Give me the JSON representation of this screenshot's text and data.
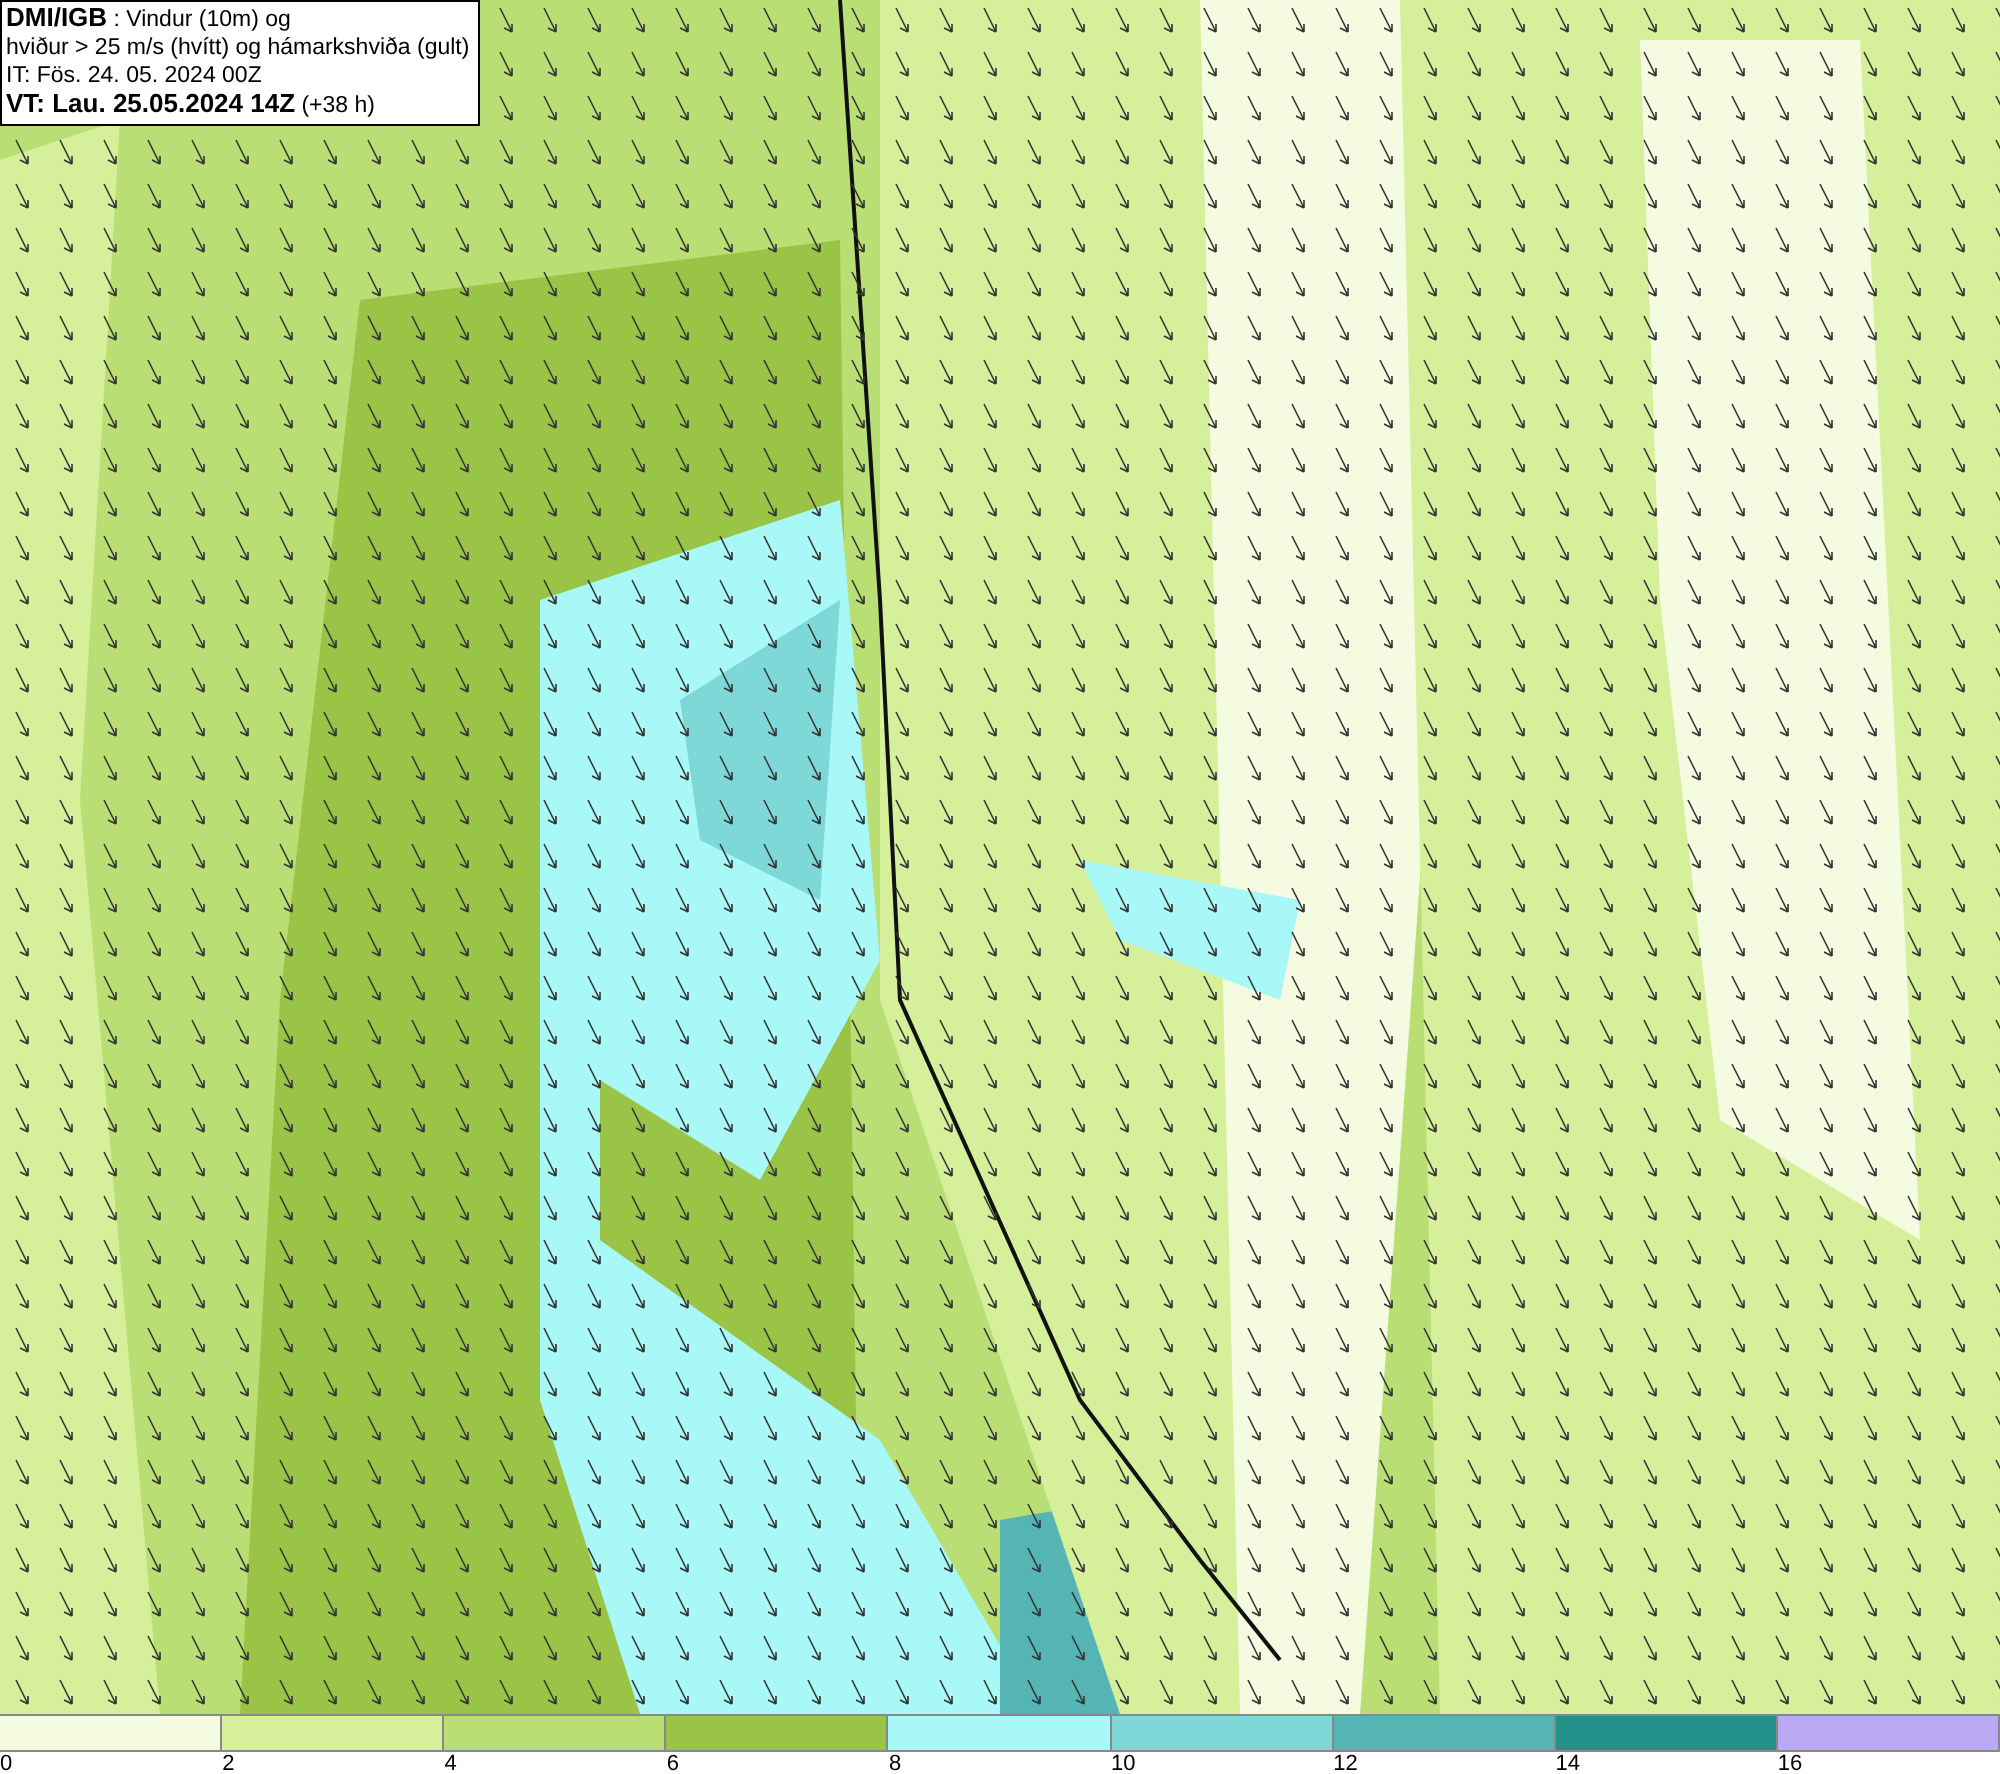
{
  "header": {
    "lines": [
      "**DMI/IGB** : Vindur (10m) og",
      "hviður > 25 m/s (hvítt) og hámarkshviða (gult)",
      "IT: Fös. 24. 05. 2024 00Z",
      "**VT: Lau. 25.05.2024 14Z** (+38 h)"
    ]
  },
  "legend": [
    {
      "label": "0",
      "color": "#f4fbe0"
    },
    {
      "label": "2",
      "color": "#d6ef9a"
    },
    {
      "label": "4",
      "color": "#b9de74"
    },
    {
      "label": "6",
      "color": "#9ac445"
    },
    {
      "label": "8",
      "color": "#a8f8f8"
    },
    {
      "label": "10",
      "color": "#7fd8d8"
    },
    {
      "label": "12",
      "color": "#55b5b5"
    },
    {
      "label": "14",
      "color": "#23908a"
    },
    {
      "label": "16",
      "color": "#bba8f5"
    }
  ]
}
